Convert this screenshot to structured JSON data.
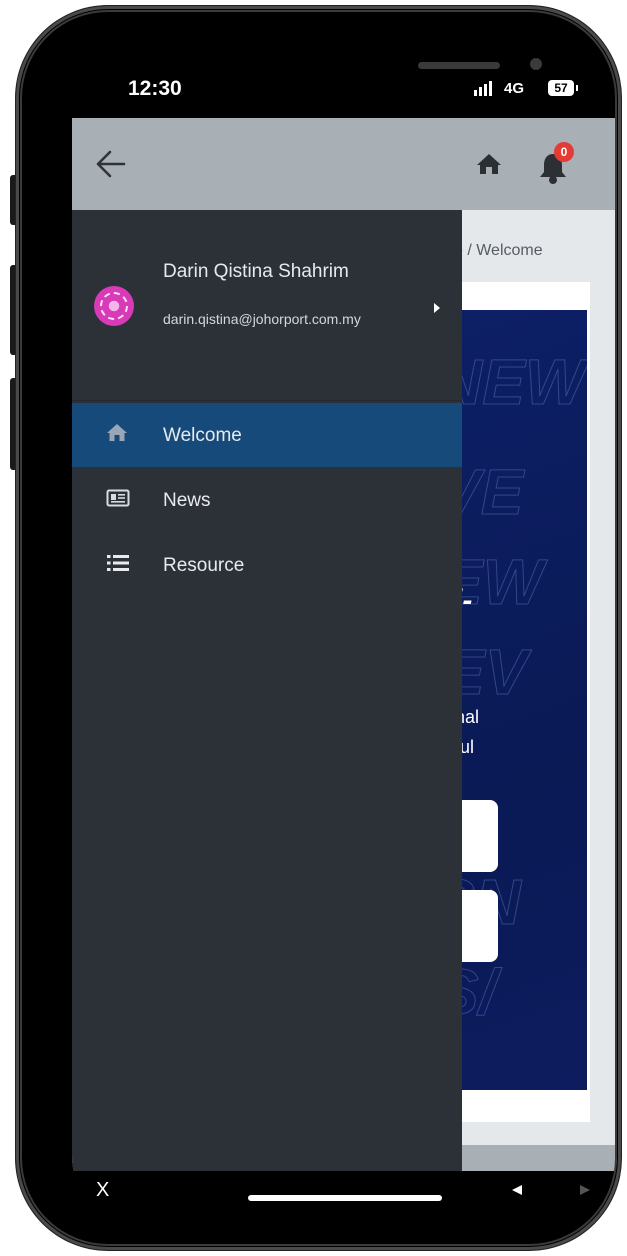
{
  "status_bar": {
    "time": "12:30",
    "network": "4G",
    "battery": "57"
  },
  "header": {
    "back_icon": "arrow-left-icon",
    "home_icon": "home-icon",
    "bell_icon": "bell-icon",
    "notification_count": "0"
  },
  "page": {
    "breadcrumb_partial": "e  /  Welcome",
    "banner_heading_partial": "i-",
    "banner_line1": "nal",
    "banner_line2": "ful"
  },
  "drawer": {
    "user_name": "Darin Qistina Shahrim",
    "user_email": "darin.qistina@johorport.com.my",
    "items": [
      {
        "label": "Welcome",
        "icon": "home-icon",
        "active": true
      },
      {
        "label": "News",
        "icon": "newspaper-icon",
        "active": false
      },
      {
        "label": "Resource",
        "icon": "list-icon",
        "active": false
      }
    ]
  },
  "navbar": {
    "close_label": "X"
  },
  "colors": {
    "drawer_bg": "#2c3138",
    "active_item": "#164a7a",
    "header_bg": "#a8b0b6",
    "badge": "#e53b35",
    "banner_bg": "#0d1f66"
  }
}
